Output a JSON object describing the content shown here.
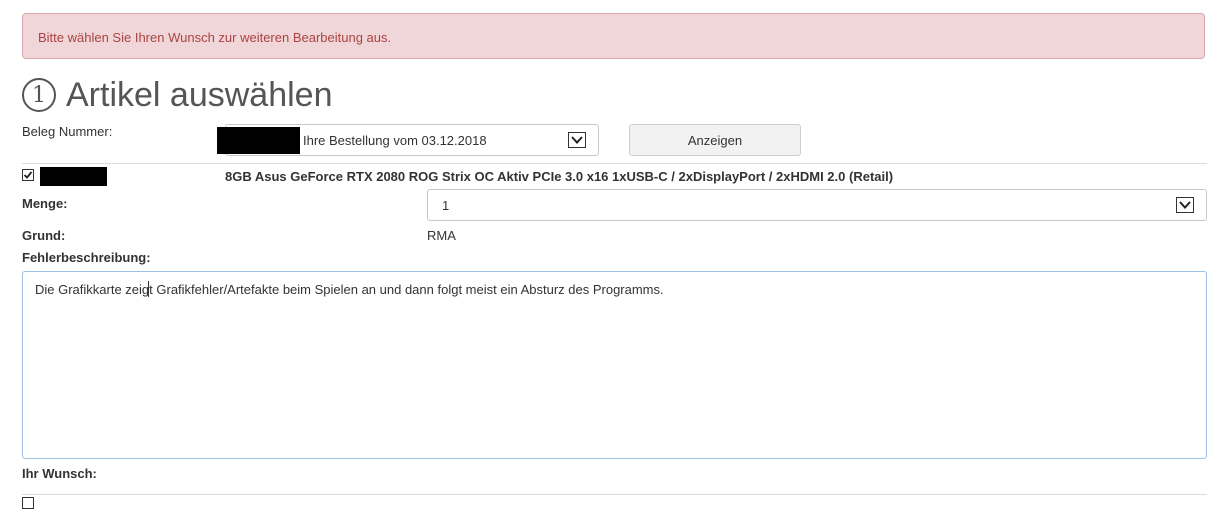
{
  "alert": {
    "message": "Bitte wählen Sie Ihren Wunsch zur weiteren Bearbeitung aus."
  },
  "section": {
    "step": "1",
    "title": "Artikel auswählen"
  },
  "beleg": {
    "label": "Beleg Nummer:",
    "selected": "Ihre Bestellung vom 03.12.2018",
    "button_label": "Anzeigen"
  },
  "article": {
    "checked": true,
    "name": "8GB Asus GeForce RTX 2080 ROG Strix OC Aktiv PCIe 3.0 x16 1xUSB-C / 2xDisplayPort / 2xHDMI 2.0 (Retail)"
  },
  "menge": {
    "label": "Menge:",
    "value": "1"
  },
  "grund": {
    "label": "Grund:",
    "value": "RMA"
  },
  "fehler": {
    "label": "Fehlerbeschreibung:",
    "text": "Die Grafikkarte zeigt Grafikfehler/Artefakte beim Spielen an und dann folgt meist ein Absturz des Programms."
  },
  "wunsch": {
    "label": "Ihr Wunsch:"
  },
  "colors": {
    "alert_bg": "#f0d6d8",
    "alert_text": "#a94442",
    "focus_border": "#9cc0e6"
  }
}
